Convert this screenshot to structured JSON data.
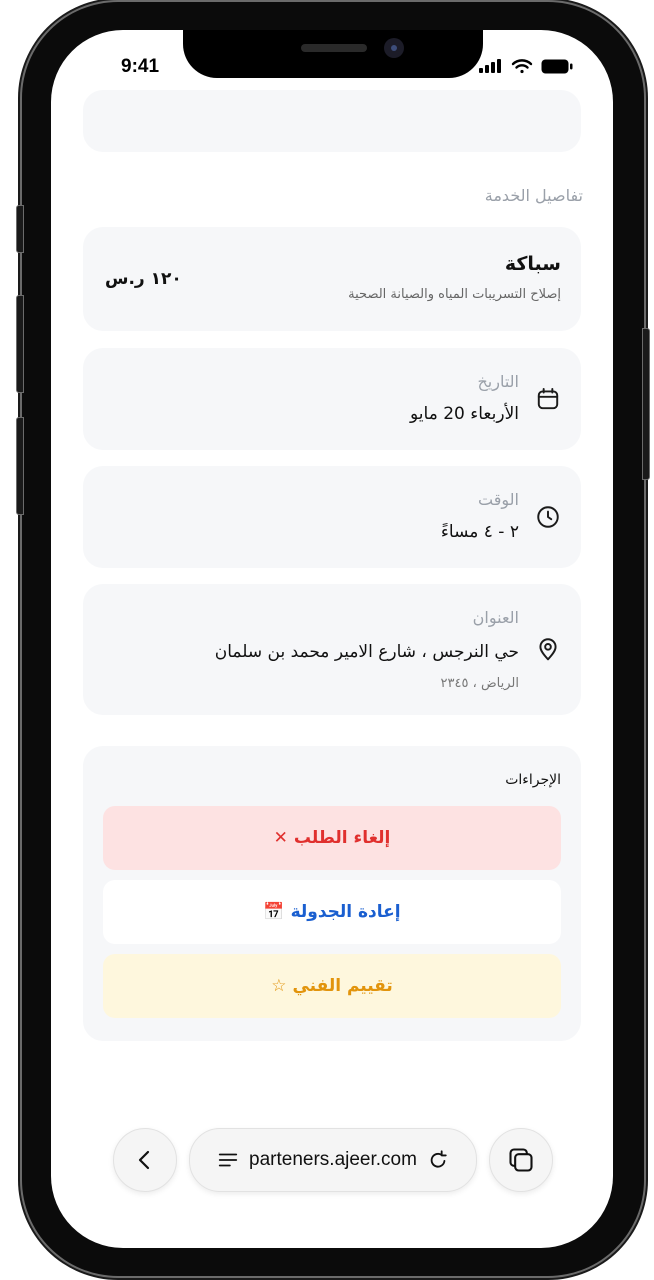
{
  "status_bar": {
    "time": "9:41"
  },
  "service_details": {
    "section_title": "تفاصيل الخدمة",
    "service_name": "سباكة",
    "service_description": "إصلاح التسريبات المياه والصيانة الصحية",
    "price": "١٢٠ ر.س"
  },
  "date": {
    "label": "التاريخ",
    "value": "الأربعاء 20 مايو",
    "icon": "calendar-icon"
  },
  "time": {
    "label": "الوقت",
    "value": "٢ - ٤ مساءً",
    "icon": "clock-icon"
  },
  "address": {
    "label": "العنوان",
    "line1": "حي النرجس ، شارع الامير محمد بن سلمان",
    "line2": "الرياض ، ٢٣٤٥",
    "icon": "location-pin-icon"
  },
  "actions": {
    "title": "الإجراءات",
    "cancel_label": "إلغاء الطلب",
    "cancel_symbol": "✕",
    "reschedule_label": "إعادة الجدولة",
    "reschedule_symbol": "📅",
    "rate_label": "تقييم الفني",
    "rate_symbol": "☆"
  },
  "browser": {
    "url": "parteners.ajeer.com"
  },
  "colors": {
    "cancel_text": "#e0302e",
    "cancel_bg": "#fde2e2",
    "reschedule_text": "#1a5fd0",
    "rate_text": "#e2940c",
    "rate_bg": "#fef7dd",
    "card_bg": "#f6f7f9"
  }
}
